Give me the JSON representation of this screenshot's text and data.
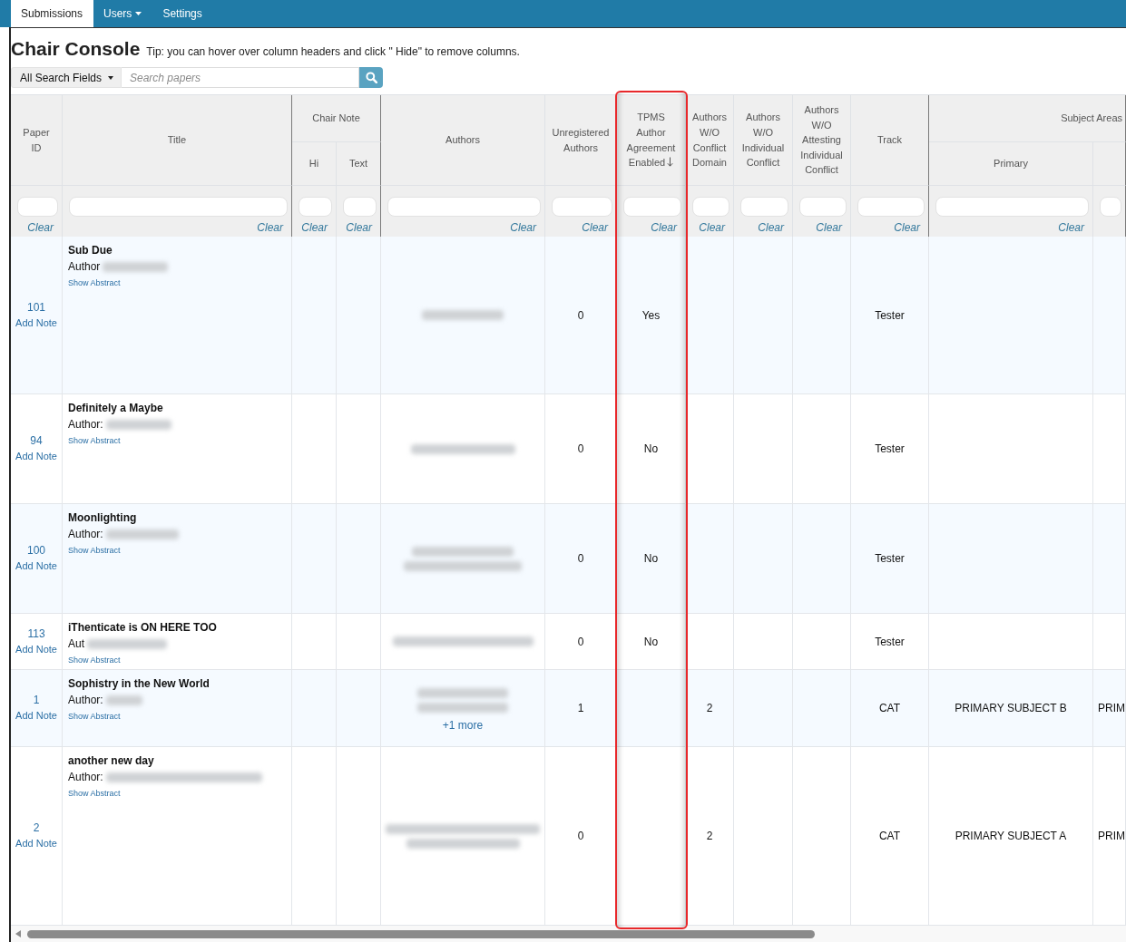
{
  "nav": {
    "tabs": [
      {
        "label": "Submissions",
        "selected": true,
        "dropdown": false
      },
      {
        "label": "Users",
        "selected": false,
        "dropdown": true
      },
      {
        "label": "Settings",
        "selected": false,
        "dropdown": false
      }
    ]
  },
  "page": {
    "title": "Chair Console",
    "tip": "Tip: you can hover over column headers and click \" Hide\" to remove columns."
  },
  "search": {
    "scope": "All Search Fields",
    "placeholder": "Search papers"
  },
  "table": {
    "columns": [
      {
        "label": "Paper ID",
        "clear_link": "Clear",
        "sorted": false,
        "highlighted": false
      },
      {
        "label": "Title",
        "clear_link": "Clear",
        "sorted": false,
        "highlighted": false
      },
      {
        "label": "Chair Note",
        "children": [
          {
            "label": "Hi",
            "clear_link": "Clear",
            "sorted": false,
            "highlighted": false
          },
          {
            "label": "Text",
            "clear_link": "Clear",
            "sorted": false,
            "highlighted": false
          }
        ]
      },
      {
        "label": "Authors",
        "clear_link": "Clear",
        "sorted": false,
        "highlighted": false
      },
      {
        "label": "Unregistered Authors",
        "clear_link": "Clear",
        "sorted": false,
        "highlighted": false
      },
      {
        "label": "TPMS Author Agreement Enabled",
        "clear_link": "Clear",
        "sorted": true,
        "highlighted": true
      },
      {
        "label": "Authors W/O Conflict Domain",
        "clear_link": "Clear",
        "sorted": false,
        "highlighted": false
      },
      {
        "label": "Authors W/O Individual Conflict",
        "clear_link": "Clear",
        "sorted": false,
        "highlighted": false
      },
      {
        "label": "Authors W/O Attesting Individual Conflict",
        "clear_link": "Clear",
        "sorted": false,
        "highlighted": false
      },
      {
        "label": "Track",
        "clear_link": "Clear",
        "sorted": false,
        "highlighted": false
      },
      {
        "label": "Subject Areas",
        "children": [
          {
            "label": "Primary",
            "clear_link": "Clear",
            "sorted": false,
            "highlighted": false
          },
          {
            "sorted": false,
            "highlighted": false
          }
        ]
      }
    ],
    "rows": [
      {
        "paper_id": "101",
        "note_link": "Add Note",
        "title": "Sub Due",
        "author_label": "Author",
        "author_redacted": true,
        "abstract_link": "Show Abstract",
        "authors": [
          {
            "redacted": true
          }
        ],
        "unregistered_authors": "0",
        "tpms_author_agreement": "Yes",
        "track": "Tester"
      },
      {
        "paper_id": "94",
        "note_link": "Add Note",
        "title": "Definitely a Maybe",
        "author_label": "Author:",
        "author_redacted": true,
        "abstract_link": "Show Abstract",
        "authors": [
          {
            "redacted": true
          }
        ],
        "unregistered_authors": "0",
        "tpms_author_agreement": "No",
        "track": "Tester"
      },
      {
        "paper_id": "100",
        "note_link": "Add Note",
        "title": "Moonlighting",
        "author_label": "Author:",
        "author_redacted": true,
        "abstract_link": "Show Abstract",
        "authors": [
          {
            "redacted": true
          },
          {
            "redacted": true
          }
        ],
        "unregistered_authors": "0",
        "tpms_author_agreement": "No",
        "track": "Tester"
      },
      {
        "paper_id": "113",
        "note_link": "Add Note",
        "title": "iThenticate is ON HERE TOO",
        "author_label": "Aut",
        "author_redacted": true,
        "abstract_link": "Show Abstract",
        "authors": [
          {
            "redacted": true
          }
        ],
        "unregistered_authors": "0",
        "tpms_author_agreement": "No",
        "track": "Tester"
      },
      {
        "paper_id": "1",
        "note_link": "Add Note",
        "title": "Sophistry in the New World",
        "author_label": "Author:",
        "author_redacted": true,
        "abstract_link": "Show Abstract",
        "authors": [
          {
            "redacted": true
          },
          {
            "redacted": true
          }
        ],
        "more_link": "+1 more",
        "unregistered_authors": "1",
        "authors_wo_conflict_domain": "2",
        "track": "CAT",
        "subject_primary": "PRIMARY SUBJECT B",
        "subject_column_2": "PRIM"
      },
      {
        "paper_id": "2",
        "note_link": "Add Note",
        "title": "another new day",
        "author_label": "Author:",
        "author_redacted": true,
        "abstract_link": "Show Abstract",
        "authors": [
          {
            "redacted": true
          },
          {
            "redacted": true
          }
        ],
        "unregistered_authors": "0",
        "authors_wo_conflict_domain": "2",
        "track": "CAT",
        "subject_primary": "PRIMARY SUBJECT A",
        "subject_column_2": "PRIM"
      }
    ]
  }
}
